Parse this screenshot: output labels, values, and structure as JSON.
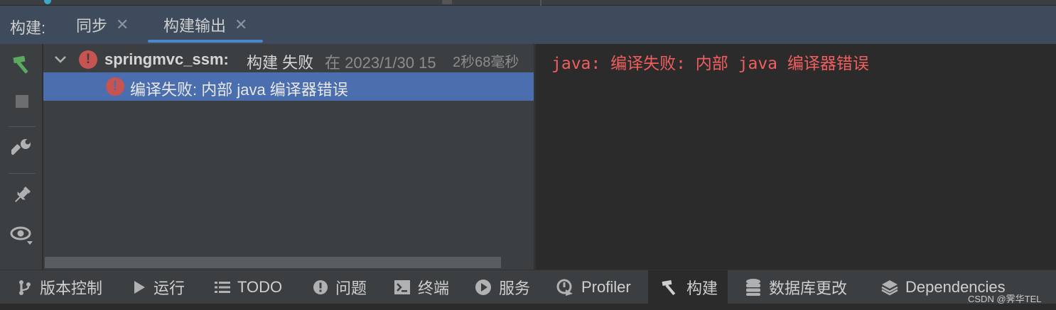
{
  "build_panel": {
    "label": "构建:",
    "tabs": [
      {
        "label": "同步",
        "active": false
      },
      {
        "label": "构建输出",
        "active": true
      }
    ]
  },
  "tree": {
    "root": {
      "project": "springmvc_ssm:",
      "status": "构建 失败",
      "time": "在 2023/1/30 15",
      "duration": "2秒68毫秒"
    },
    "child": {
      "message": "编译失败: 内部 java 编译器错误"
    }
  },
  "output": {
    "line": "java: 编译失败: 内部 java 编译器错误"
  },
  "bottom_tabs": [
    {
      "label": "版本控制",
      "icon": "branch-icon"
    },
    {
      "label": "运行",
      "icon": "play-icon"
    },
    {
      "label": "TODO",
      "icon": "list-icon"
    },
    {
      "label": "问题",
      "icon": "problem-icon"
    },
    {
      "label": "终端",
      "icon": "terminal-icon"
    },
    {
      "label": "服务",
      "icon": "services-icon"
    },
    {
      "label": "Profiler",
      "icon": "profiler-icon"
    },
    {
      "label": "构建",
      "icon": "hammer-icon",
      "active": true
    },
    {
      "label": "数据库更改",
      "icon": "database-icon"
    },
    {
      "label": "Dependencies",
      "icon": "layers-icon"
    }
  ],
  "watermark": "CSDN @霁华TEL",
  "colors": {
    "tab_bar": "#3d4b5c",
    "selection": "#4b6eaf",
    "error": "#c75450",
    "output_error_text": "#f25e5e",
    "hammer_green": "#5aa960"
  }
}
